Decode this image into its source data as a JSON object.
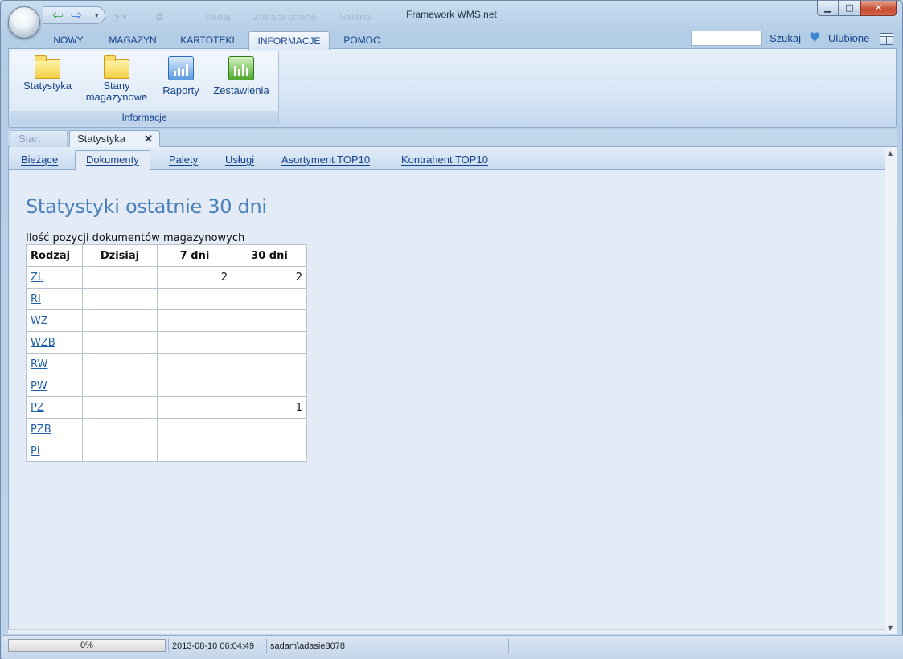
{
  "window": {
    "title": "Framework WMS.net",
    "minimize": "▁",
    "maximize": "□",
    "close": "✕"
  },
  "quick_access": {
    "faint_items": [
      "◔ ▾",
      "◘",
      "Dodaj",
      "Zobacz stronę",
      "Galeria"
    ]
  },
  "ribbon": {
    "tabs": [
      {
        "label": "NOWY"
      },
      {
        "label": "MAGAZYN"
      },
      {
        "label": "KARTOTEKI"
      },
      {
        "label": "INFORMACJE",
        "active": true
      },
      {
        "label": "POMOC"
      }
    ],
    "search": {
      "value": "",
      "label": "Szukaj"
    },
    "favorites_label": "Ulubione",
    "group": {
      "label": "Informacje",
      "buttons": [
        {
          "line1": "Statystyka",
          "line2": "",
          "icon": "folder-icon"
        },
        {
          "line1": "Stany",
          "line2": "magazynowe",
          "icon": "folder-icon"
        },
        {
          "line1": "Raporty",
          "line2": "",
          "icon": "report-chart-icon"
        },
        {
          "line1": "Zestawienia",
          "line2": "",
          "icon": "summary-chart-icon"
        }
      ]
    }
  },
  "doc_tabs": {
    "start": "Start",
    "active": "Statystyka",
    "close": "✕"
  },
  "subtabs": [
    {
      "label": "Bieżące"
    },
    {
      "label": "Dokumenty",
      "active": true
    },
    {
      "label": "Palety"
    },
    {
      "label": "Usługi"
    },
    {
      "label": "Asortyment TOP10"
    },
    {
      "label": "Kontrahent TOP10"
    }
  ],
  "main": {
    "heading": "Statystyki ostatnie 30 dni",
    "caption": "Ilość pozycji dokumentów magazynowych",
    "columns": [
      "Rodzaj",
      "Dzisiaj",
      "7 dni",
      "30 dni"
    ],
    "rows": [
      {
        "kind": "ZL",
        "today": "",
        "week": "2",
        "month": "2"
      },
      {
        "kind": "RI",
        "today": "",
        "week": "",
        "month": ""
      },
      {
        "kind": "WZ",
        "today": "",
        "week": "",
        "month": ""
      },
      {
        "kind": "WZB",
        "today": "",
        "week": "",
        "month": ""
      },
      {
        "kind": "RW",
        "today": "",
        "week": "",
        "month": ""
      },
      {
        "kind": "PW",
        "today": "",
        "week": "",
        "month": ""
      },
      {
        "kind": "PZ",
        "today": "",
        "week": "",
        "month": "1"
      },
      {
        "kind": "PZB",
        "today": "",
        "week": "",
        "month": ""
      },
      {
        "kind": "PI",
        "today": "",
        "week": "",
        "month": ""
      }
    ]
  },
  "status": {
    "progress_text": "0%",
    "progress_value": 0,
    "datetime": "2013-08-10 06:04:49",
    "user": "sadam\\adasie3078"
  },
  "colors": {
    "accent": "#15428b",
    "heading": "#4a80b9",
    "link": "#1d5ea8"
  }
}
